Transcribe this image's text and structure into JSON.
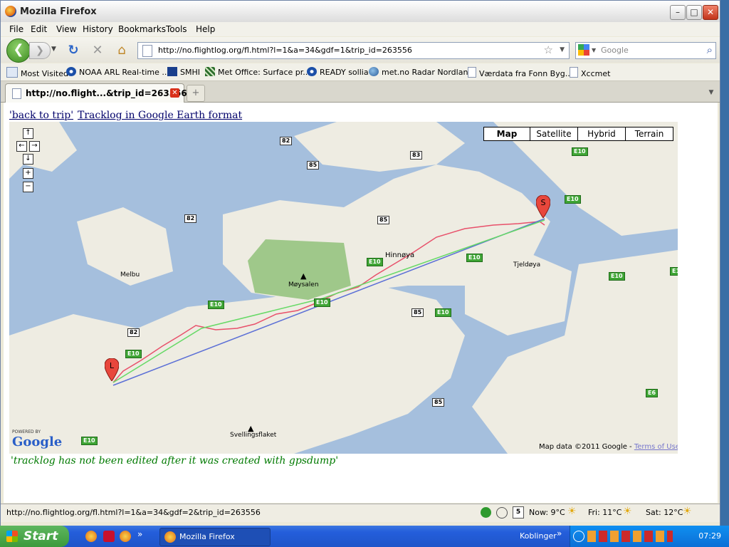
{
  "window": {
    "title": "Mozilla Firefox"
  },
  "menu": [
    "File",
    "Edit",
    "View",
    "History",
    "Bookmarks",
    "Tools",
    "Help"
  ],
  "nav": {
    "url": "http://no.flightlog.org/fl.html?l=1&a=34&gdf=1&trip_id=263556",
    "search_placeholder": "Google"
  },
  "bookmarks": [
    "Most Visited",
    "NOAA ARL Real-time ...",
    "SMHI",
    "Met Office: Surface pr...",
    "READY sollia",
    "met.no Radar Nordland",
    "Værdata fra Fonn Byg...",
    "Xccmet"
  ],
  "tab": {
    "title": "http://no.flight...&trip_id=263556"
  },
  "page": {
    "link_back": "'back to trip'",
    "link_tracklog": "Tracklog in Google Earth format",
    "note": "'tracklog has not been edited after it was created with gpsdump'"
  },
  "map": {
    "types": [
      "Map",
      "Satellite",
      "Hybrid",
      "Terrain"
    ],
    "zoom_controls": [
      "↑",
      "←",
      "→",
      "↓",
      "+",
      "−"
    ],
    "places": [
      "Hinnøya",
      "Møysalen",
      "Melbu",
      "Tjeldøya",
      "Svellingsflaket"
    ],
    "road_labels": [
      "82",
      "85",
      "83",
      "E10",
      "E6"
    ],
    "powered_by": "POWERED BY",
    "google": "Google",
    "attribution": "Map data ©2011 Google - ",
    "terms": "Terms of Use",
    "markers": {
      "start": "S",
      "landing": "L"
    },
    "colors": {
      "track": "#e8506a",
      "line_blue": "#5b6fd6",
      "line_green": "#66d966",
      "land": "#eeece2",
      "water": "#a5bfdd",
      "park": "#9fc88a"
    }
  },
  "status": {
    "url": "http://no.flightlog.org/fl.html?l=1&a=34&gdf=2&trip_id=263556",
    "calendar_day": "5",
    "now": "Now: 9°C",
    "fri": "Fri: 11°C",
    "sat": "Sat: 12°C"
  },
  "taskbar": {
    "start": "Start",
    "task": "Mozilla Firefox",
    "links": "Koblinger",
    "clock": "07:29"
  }
}
